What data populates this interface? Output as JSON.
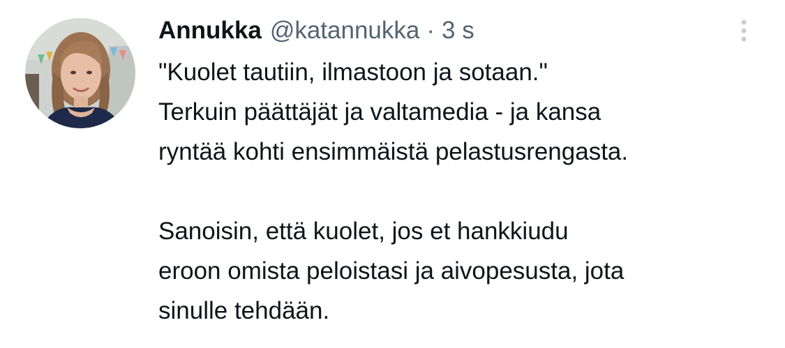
{
  "tweet": {
    "display_name": "Annukka",
    "handle": "@katannukka",
    "separator": "·",
    "time": "3 s",
    "lines": [
      "\"Kuolet tautiin, ilmastoon ja sotaan.\"",
      "Terkuin päättäjät ja valtamedia - ja kansa",
      "ryntää kohti ensimmäistä pelastusrengasta.",
      "",
      "Sanoisin, että kuolet, jos et hankkiudu",
      "eroon omista peloistasi ja aivopesusta, jota",
      "sinulle tehdään."
    ]
  },
  "icons": {
    "avatar": "user-avatar-photo",
    "more": "more-vertical-icon"
  },
  "colors": {
    "text_primary": "#0f1419",
    "text_secondary": "#536471",
    "background": "#ffffff"
  }
}
